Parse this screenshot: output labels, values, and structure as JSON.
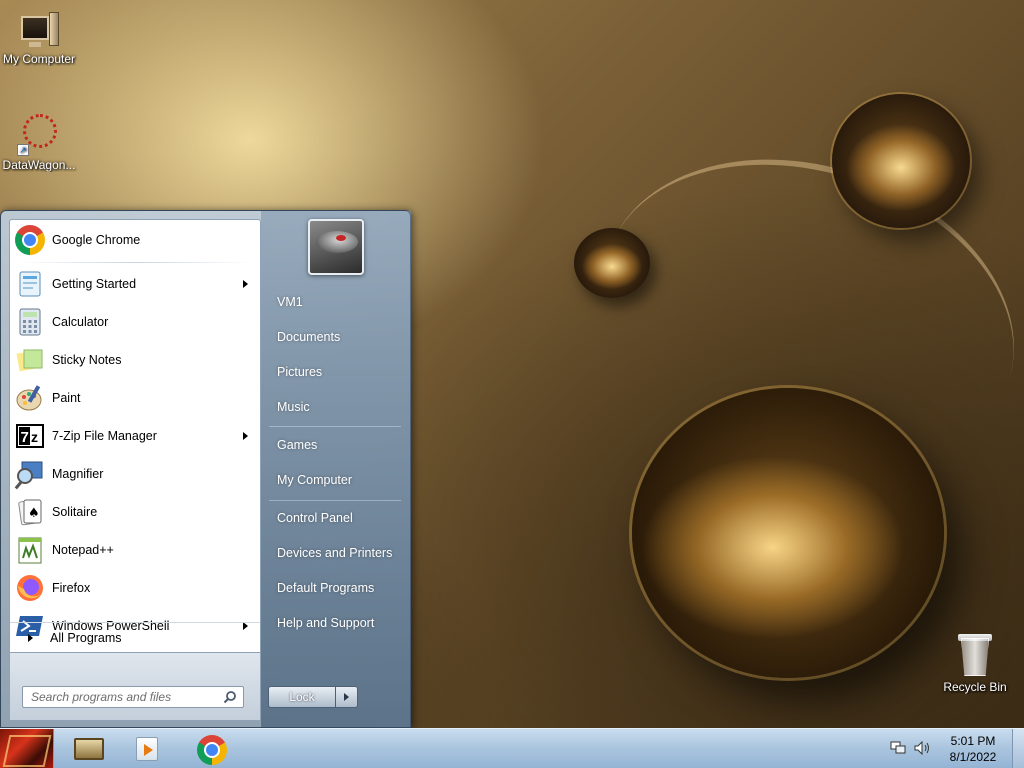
{
  "desktop": {
    "icons": [
      {
        "label": "My Computer",
        "icon": "computer-icon"
      },
      {
        "label": "DataWagon...",
        "icon": "datawagon-icon"
      },
      {
        "label": "Recycle Bin",
        "icon": "recycle-bin-icon"
      }
    ]
  },
  "start_menu": {
    "programs": [
      {
        "label": "Google Chrome",
        "icon": "chrome-icon",
        "submenu": false
      },
      {
        "label": "Getting Started",
        "icon": "getting-started-icon",
        "submenu": true
      },
      {
        "label": "Calculator",
        "icon": "calculator-icon",
        "submenu": false
      },
      {
        "label": "Sticky Notes",
        "icon": "sticky-notes-icon",
        "submenu": false
      },
      {
        "label": "Paint",
        "icon": "paint-icon",
        "submenu": false
      },
      {
        "label": "7-Zip File Manager",
        "icon": "7zip-icon",
        "submenu": true
      },
      {
        "label": "Magnifier",
        "icon": "magnifier-icon",
        "submenu": false
      },
      {
        "label": "Solitaire",
        "icon": "solitaire-icon",
        "submenu": false
      },
      {
        "label": "Notepad++",
        "icon": "notepad-plus-plus-icon",
        "submenu": false
      },
      {
        "label": "Firefox",
        "icon": "firefox-icon",
        "submenu": false
      },
      {
        "label": "Windows PowerShell",
        "icon": "powershell-icon",
        "submenu": true
      }
    ],
    "all_programs": "All Programs",
    "search_placeholder": "Search programs and files",
    "right_items": [
      {
        "label": "VM1"
      },
      {
        "label": "Documents"
      },
      {
        "label": "Pictures"
      },
      {
        "label": "Music"
      },
      {
        "label": "Games"
      },
      {
        "label": "My Computer"
      },
      {
        "label": "Control Panel"
      },
      {
        "label": "Devices and Printers"
      },
      {
        "label": "Default Programs"
      },
      {
        "label": "Help and Support"
      }
    ],
    "lock_label": "Lock"
  },
  "taskbar": {
    "pinned": [
      {
        "icon": "windows-explorer-icon"
      },
      {
        "icon": "media-player-icon"
      },
      {
        "icon": "chrome-icon"
      }
    ],
    "time": "5:01 PM",
    "date": "8/1/2022"
  }
}
